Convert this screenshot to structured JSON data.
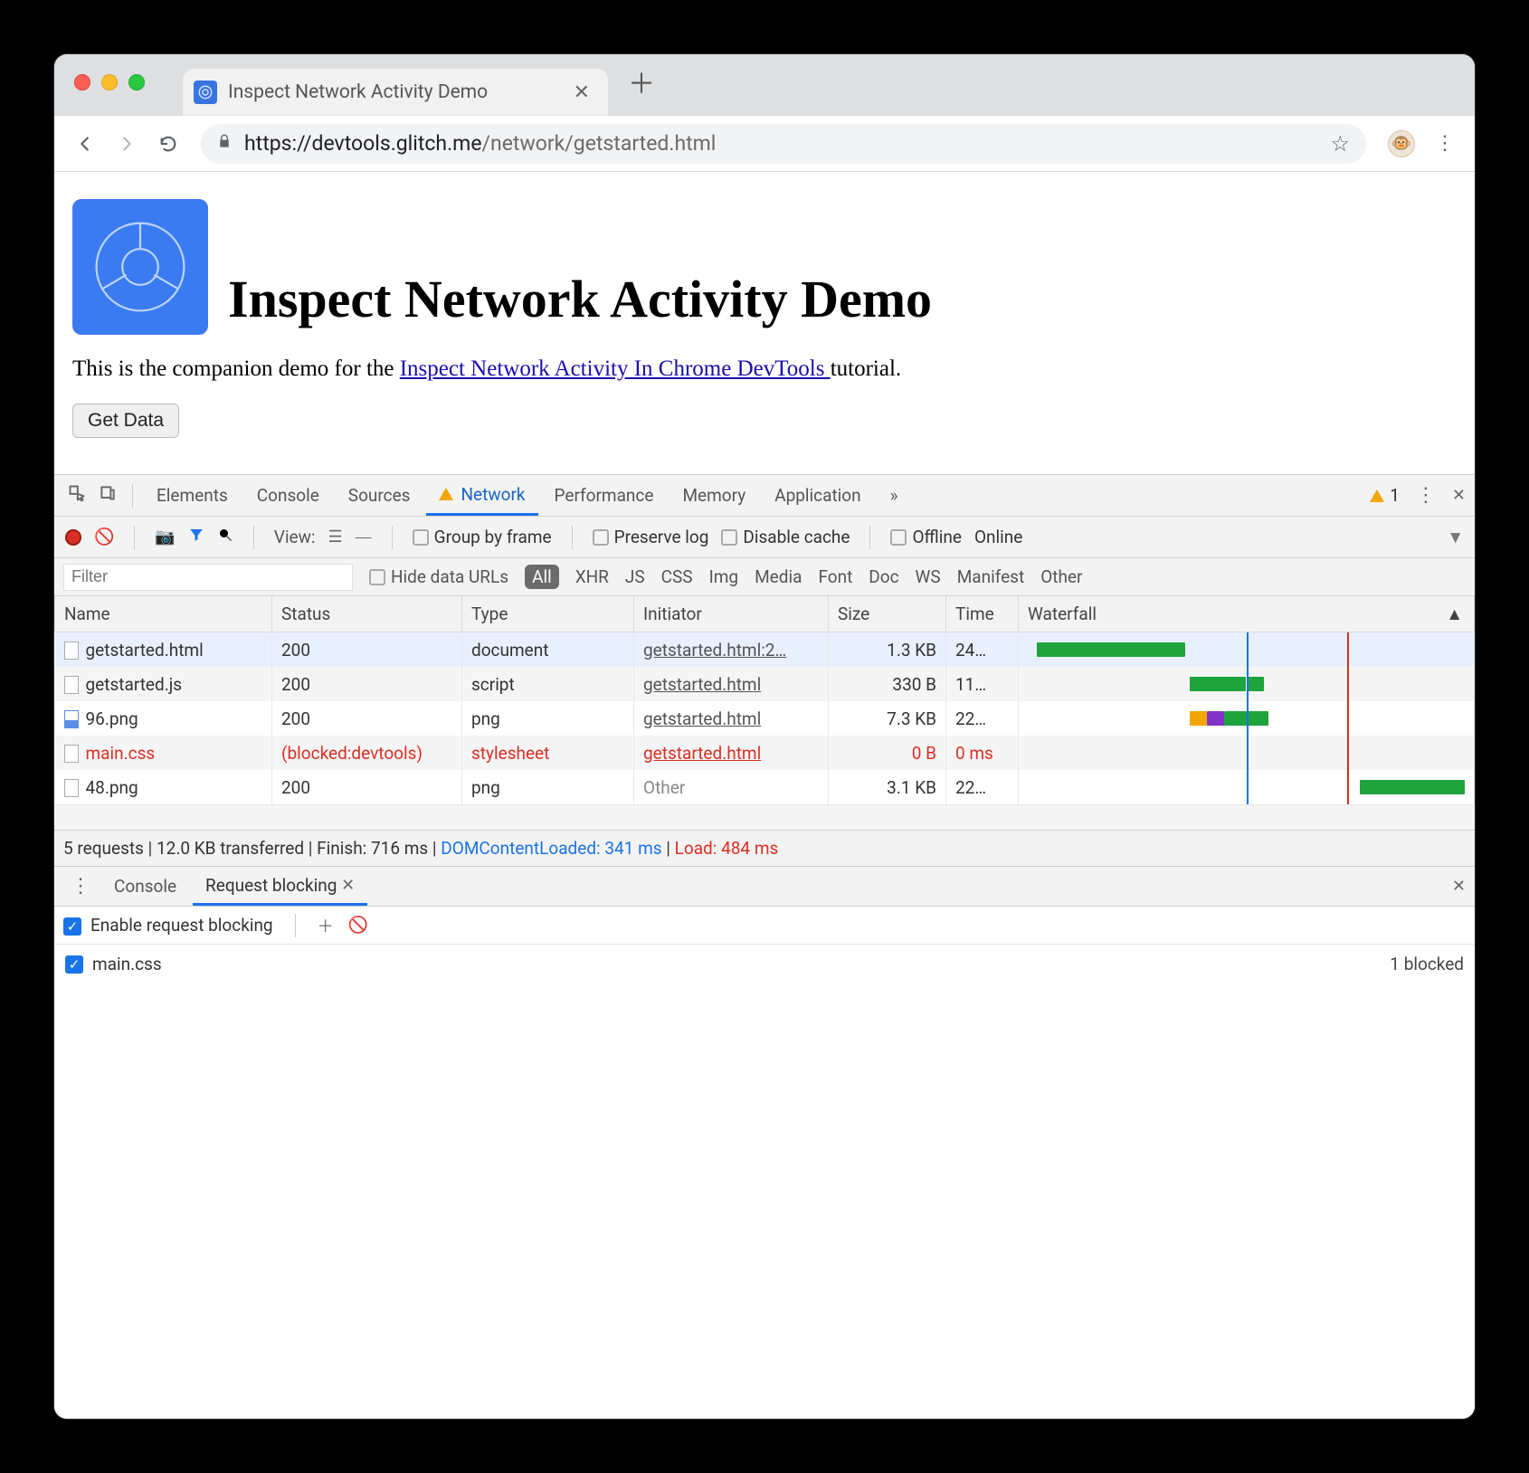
{
  "window": {
    "tab_title": "Inspect Network Activity Demo",
    "new_tab_glyph": "＋"
  },
  "toolbar": {
    "url_scheme_host": "https://devtools.glitch.me",
    "url_path": "/network/getstarted.html"
  },
  "page": {
    "heading": "Inspect Network Activity Demo",
    "intro_pre": "This is the companion demo for the ",
    "intro_link": "Inspect Network Activity In Chrome DevTools ",
    "intro_post": "tutorial.",
    "button": "Get Data"
  },
  "devtools": {
    "tabs": {
      "elements": "Elements",
      "console": "Console",
      "sources": "Sources",
      "network": "Network",
      "performance": "Performance",
      "memory": "Memory",
      "application": "Application",
      "more": "»"
    },
    "warning_count": "1",
    "netbar": {
      "view": "View:",
      "group": "Group by frame",
      "preserve": "Preserve log",
      "disable": "Disable cache",
      "offline": "Offline",
      "online": "Online"
    },
    "filter": {
      "placeholder": "Filter",
      "hide": "Hide data URLs",
      "types": {
        "all": "All",
        "xhr": "XHR",
        "js": "JS",
        "css": "CSS",
        "img": "Img",
        "media": "Media",
        "font": "Font",
        "doc": "Doc",
        "ws": "WS",
        "manifest": "Manifest",
        "other": "Other"
      }
    },
    "columns": {
      "name": "Name",
      "status": "Status",
      "type": "Type",
      "initiator": "Initiator",
      "size": "Size",
      "time": "Time",
      "waterfall": "Waterfall"
    },
    "rows": [
      {
        "name": "getstarted.html",
        "status": "200",
        "type": "document",
        "initiator": "getstarted.html:2…",
        "size": "1.3 KB",
        "time": "24…",
        "icon": "doc",
        "blocked": false,
        "selected": true,
        "wf": [
          {
            "l": 2,
            "w": 34,
            "c": "#1fa33c"
          }
        ]
      },
      {
        "name": "getstarted.js",
        "status": "200",
        "type": "script",
        "initiator": "getstarted.html",
        "size": "330 B",
        "time": "11…",
        "icon": "doc",
        "blocked": false,
        "wf": [
          {
            "l": 37,
            "w": 13,
            "c": "#1fa33c"
          },
          {
            "l": 50,
            "w": 4,
            "c": "#1fa33c"
          }
        ]
      },
      {
        "name": "96.png",
        "status": "200",
        "type": "png",
        "initiator": "getstarted.html",
        "size": "7.3 KB",
        "time": "22…",
        "icon": "img",
        "blocked": false,
        "wf": [
          {
            "l": 37,
            "w": 4,
            "c": "#f2a600"
          },
          {
            "l": 41,
            "w": 4,
            "c": "#8133c7"
          },
          {
            "l": 45,
            "w": 10,
            "c": "#1fa33c"
          }
        ]
      },
      {
        "name": "main.css",
        "status": "(blocked:devtools)",
        "type": "stylesheet",
        "initiator": "getstarted.html",
        "size": "0 B",
        "time": "0 ms",
        "icon": "doc",
        "blocked": true,
        "wf": []
      },
      {
        "name": "48.png",
        "status": "200",
        "type": "png",
        "initiator": "Other",
        "initiator_other": true,
        "size": "3.1 KB",
        "time": "22…",
        "icon": "doc",
        "blocked": false,
        "wf": [
          {
            "l": 76,
            "w": 24,
            "c": "#1fa33c"
          }
        ]
      }
    ],
    "wf_lines": [
      {
        "l": 50,
        "c": "#1a73e8"
      },
      {
        "l": 73,
        "c": "#d93025"
      }
    ],
    "summary": {
      "requests": "5 requests",
      "transferred": "12.0 KB transferred",
      "finish": "Finish: 716 ms",
      "dcl": "DOMContentLoaded: 341 ms",
      "load": "Load: 484 ms"
    },
    "drawer": {
      "console": "Console",
      "reqblock": "Request blocking",
      "enable": "Enable request blocking",
      "pattern": "main.css",
      "blocked_count": "1 blocked"
    }
  }
}
